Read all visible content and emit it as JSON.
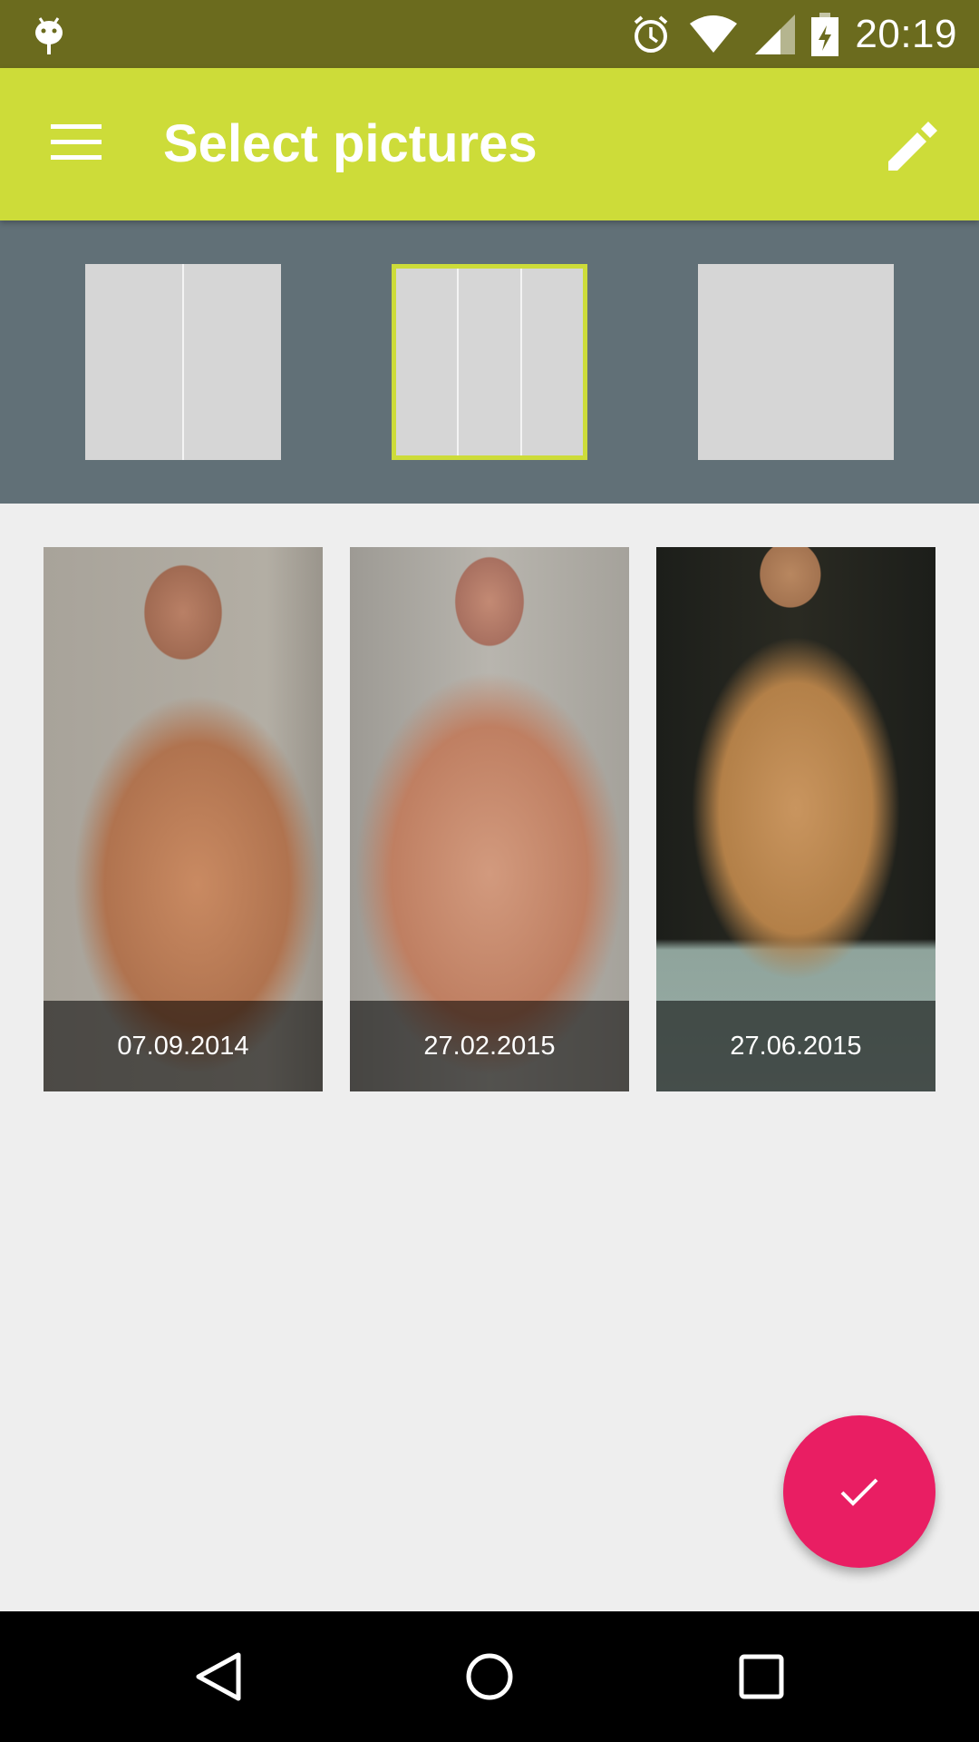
{
  "status_bar": {
    "time": "20:19",
    "icons": [
      "android-debug-icon",
      "alarm-icon",
      "wifi-icon",
      "signal-icon",
      "battery-charging-icon"
    ]
  },
  "toolbar": {
    "title": "Select pictures",
    "menu_icon": "hamburger-menu-icon",
    "action_icon": "pencil-edit-icon",
    "color": "#cddc39"
  },
  "layout_picker": {
    "background": "#617077",
    "selected_index": 1,
    "options": [
      {
        "name": "two-columns",
        "columns": 2
      },
      {
        "name": "three-columns",
        "columns": 3
      },
      {
        "name": "single",
        "columns": 1
      }
    ]
  },
  "photos": [
    {
      "date": "07.09.2014"
    },
    {
      "date": "27.02.2015"
    },
    {
      "date": "27.06.2015"
    }
  ],
  "fab": {
    "icon": "check-icon",
    "color": "#e91e63"
  },
  "nav_bar": {
    "buttons": [
      "back-icon",
      "home-icon",
      "recents-icon"
    ]
  }
}
